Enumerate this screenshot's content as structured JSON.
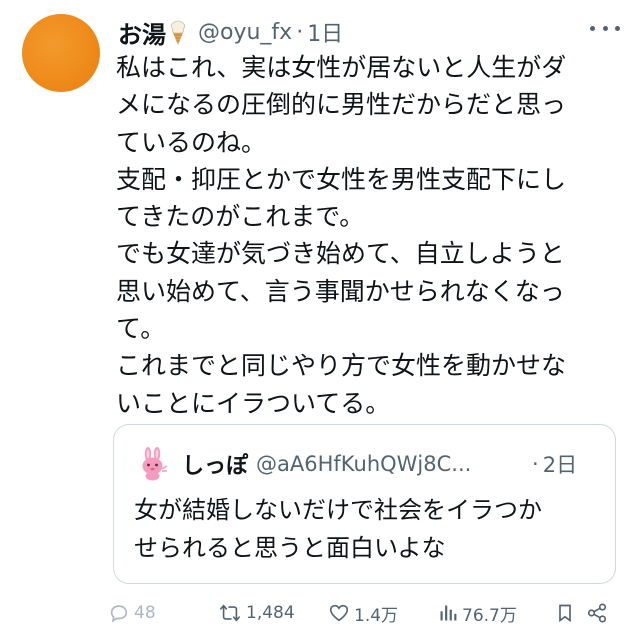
{
  "tweet": {
    "author": {
      "display_name": "お湯",
      "name_emoji": "soft-ice-cream-icon",
      "handle": "@oyu_fx",
      "time": "1日",
      "avatar_color": "#ee8a1a"
    },
    "separator": "·",
    "body_lines": [
      "私はこれ、実は女性が居ないと人生がダ",
      "メになるの圧倒的に男性だからだと思っ",
      "ているのね。",
      "支配・抑圧とかで女性を男性支配下にし",
      "てきたのがこれまで。",
      "でも女達が気づき始めて、自立しようと",
      "思い始めて、言う事聞かせられなくなっ",
      "て。",
      "これまでと同じやり方で女性を動かせな",
      "いことにイラついてる。"
    ],
    "quote": {
      "display_name": "しっぽ",
      "handle": "@aA6HfKuhQWj8C...",
      "time": "2日",
      "avatar_icon": "pink-rabbit-icon",
      "body_lines": [
        "女が結婚しないだけで社会をイラつか",
        "せられると思うと面白いよな"
      ]
    },
    "actions": {
      "replies": "48",
      "retweets": "1,484",
      "likes": "1.4万",
      "views": "76.7万"
    }
  },
  "colors": {
    "text": "#0f1419",
    "secondary": "#536471",
    "border": "#cfd9de"
  }
}
